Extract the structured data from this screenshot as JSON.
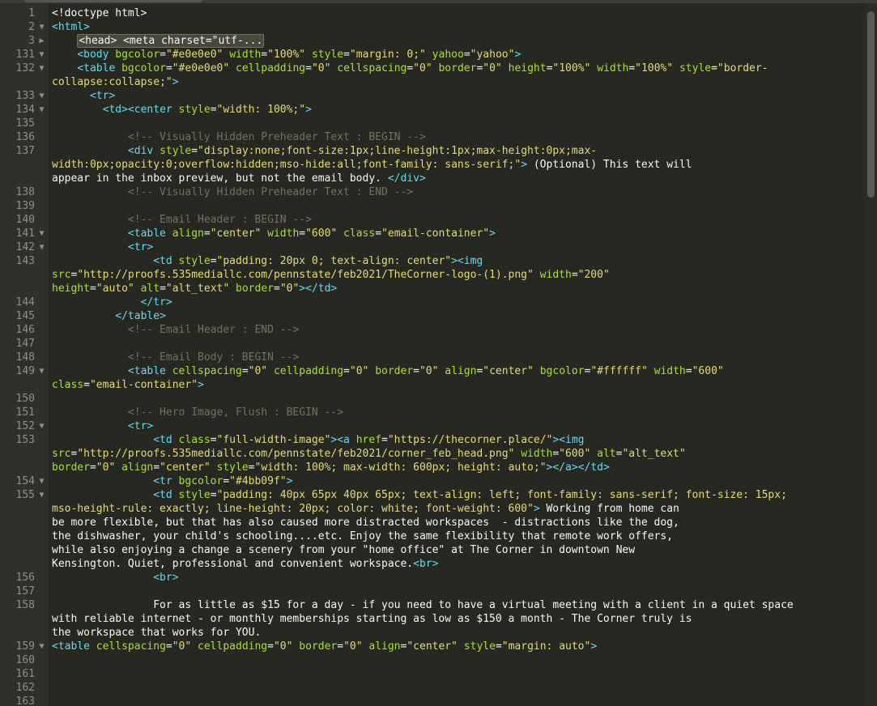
{
  "editor": {
    "lines": [
      {
        "n": "1",
        "fold": "",
        "html": "<span class=\"p\">&lt;!doctype html&gt;</span>"
      },
      {
        "n": "2",
        "fold": "▼",
        "html": "<span class=\"t\">&lt;html&gt;</span>"
      },
      {
        "n": "3",
        "fold": "▶",
        "html": "    <span class=\"folded\">&lt;head&gt; &lt;meta charset=\"utf-...</span>"
      },
      {
        "n": "131",
        "fold": "▼",
        "html": "    <span class=\"t\">&lt;body</span> <span class=\"a\">bgcolor</span>=<span class=\"s\">\"#e0e0e0\"</span> <span class=\"a\">width</span>=<span class=\"s\">\"100%\"</span> <span class=\"a\">style</span>=<span class=\"s\">\"margin: 0;\"</span> <span class=\"a\">yahoo</span>=<span class=\"s\">\"yahoo\"</span><span class=\"t\">&gt;</span>"
      },
      {
        "n": "132",
        "fold": "▼",
        "html": "    <span class=\"t\">&lt;table</span> <span class=\"a\">bgcolor</span>=<span class=\"s\">\"#e0e0e0\"</span> <span class=\"a\">cellpadding</span>=<span class=\"s\">\"0\"</span> <span class=\"a\">cellspacing</span>=<span class=\"s\">\"0\"</span> <span class=\"a\">border</span>=<span class=\"s\">\"0\"</span> <span class=\"a\">height</span>=<span class=\"s\">\"100%\"</span> <span class=\"a\">width</span>=<span class=\"s\">\"100%\"</span> <span class=\"a\">style</span>=<span class=\"s\">\"border-\ncollapse:collapse;\"</span><span class=\"t\">&gt;</span>"
      },
      {
        "n": "133",
        "fold": "▼",
        "html": "      <span class=\"t\">&lt;tr&gt;</span>"
      },
      {
        "n": "134",
        "fold": "▼",
        "html": "        <span class=\"t\">&lt;td&gt;&lt;center</span> <span class=\"a\">style</span>=<span class=\"s\">\"width: 100%;\"</span><span class=\"t\">&gt;</span>"
      },
      {
        "n": "135",
        "fold": "",
        "html": ""
      },
      {
        "n": "136",
        "fold": "",
        "html": "            <span class=\"c\">&lt;!-- Visually Hidden Preheader Text : BEGIN --&gt;</span>"
      },
      {
        "n": "137",
        "fold": "",
        "html": "            <span class=\"t\">&lt;div</span> <span class=\"a\">style</span>=<span class=\"s\">\"display:none;font-size:1px;line-height:1px;max-height:0px;max-\nwidth:0px;opacity:0;overflow:hidden;mso-hide:all;font-family: sans-serif;\"</span><span class=\"t\">&gt;</span> (Optional) This text will\nappear in the inbox preview, but not the email body. <span class=\"t\">&lt;/div&gt;</span>"
      },
      {
        "n": "138",
        "fold": "",
        "html": "            <span class=\"c\">&lt;!-- Visually Hidden Preheader Text : END --&gt;</span>"
      },
      {
        "n": "139",
        "fold": "",
        "html": ""
      },
      {
        "n": "140",
        "fold": "",
        "html": "            <span class=\"c\">&lt;!-- Email Header : BEGIN --&gt;</span>"
      },
      {
        "n": "141",
        "fold": "▼",
        "html": "            <span class=\"t\">&lt;table</span> <span class=\"a\">align</span>=<span class=\"s\">\"center\"</span> <span class=\"a\">width</span>=<span class=\"s\">\"600\"</span> <span class=\"a\">class</span>=<span class=\"s\">\"email-container\"</span><span class=\"t\">&gt;</span>"
      },
      {
        "n": "142",
        "fold": "▼",
        "html": "            <span class=\"t\">&lt;tr&gt;</span>"
      },
      {
        "n": "143",
        "fold": "",
        "html": "                <span class=\"t\">&lt;td</span> <span class=\"a\">style</span>=<span class=\"s\">\"padding: 20px 0; text-align: center\"</span><span class=\"t\">&gt;&lt;img</span>\n<span class=\"a\">src</span>=<span class=\"s\">\"http://proofs.535mediallc.com/pennstate/feb2021/TheCorner-logo-(1).png\"</span> <span class=\"a\">width</span>=<span class=\"s\">\"200\"</span>\n<span class=\"a\">height</span>=<span class=\"s\">\"auto\"</span> <span class=\"a\">alt</span>=<span class=\"s\">\"alt_text\"</span> <span class=\"a\">border</span>=<span class=\"s\">\"0\"</span><span class=\"t\">&gt;&lt;/td&gt;</span>"
      },
      {
        "n": "144",
        "fold": "",
        "html": "              <span class=\"t\">&lt;/tr&gt;</span>"
      },
      {
        "n": "145",
        "fold": "",
        "html": "          <span class=\"t\">&lt;/table&gt;</span>"
      },
      {
        "n": "146",
        "fold": "",
        "html": "            <span class=\"c\">&lt;!-- Email Header : END --&gt;</span>"
      },
      {
        "n": "147",
        "fold": "",
        "html": ""
      },
      {
        "n": "148",
        "fold": "",
        "html": "            <span class=\"c\">&lt;!-- Email Body : BEGIN --&gt;</span>"
      },
      {
        "n": "149",
        "fold": "▼",
        "html": "            <span class=\"t\">&lt;table</span> <span class=\"a\">cellspacing</span>=<span class=\"s\">\"0\"</span> <span class=\"a\">cellpadding</span>=<span class=\"s\">\"0\"</span> <span class=\"a\">border</span>=<span class=\"s\">\"0\"</span> <span class=\"a\">align</span>=<span class=\"s\">\"center\"</span> <span class=\"a\">bgcolor</span>=<span class=\"s\">\"#ffffff\"</span> <span class=\"a\">width</span>=<span class=\"s\">\"600\"</span>\n<span class=\"a\">class</span>=<span class=\"s\">\"email-container\"</span><span class=\"t\">&gt;</span>"
      },
      {
        "n": "150",
        "fold": "",
        "html": ""
      },
      {
        "n": "151",
        "fold": "",
        "html": "            <span class=\"c\">&lt;!-- Hero Image, Flush : BEGIN --&gt;</span>"
      },
      {
        "n": "152",
        "fold": "▼",
        "html": "            <span class=\"t\">&lt;tr&gt;</span>"
      },
      {
        "n": "153",
        "fold": "",
        "html": "                <span class=\"t\">&lt;td</span> <span class=\"a\">class</span>=<span class=\"s\">\"full-width-image\"</span><span class=\"t\">&gt;&lt;a</span> <span class=\"a\">href</span>=<span class=\"s\">\"https://thecorner.place/\"</span><span class=\"t\">&gt;&lt;img</span>\n<span class=\"a\">src</span>=<span class=\"s\">\"http://proofs.535mediallc.com/pennstate/feb2021/corner_feb_head.png\"</span> <span class=\"a\">width</span>=<span class=\"s\">\"600\"</span> <span class=\"a\">alt</span>=<span class=\"s\">\"alt_text\"</span>\n<span class=\"a\">border</span>=<span class=\"s\">\"0\"</span> <span class=\"a\">align</span>=<span class=\"s\">\"center\"</span> <span class=\"a\">style</span>=<span class=\"s\">\"width: 100%; max-width: 600px; height: auto;\"</span><span class=\"t\">&gt;&lt;/a&gt;&lt;/td&gt;</span>"
      },
      {
        "n": "154",
        "fold": "▼",
        "html": "                <span class=\"t\">&lt;tr</span> <span class=\"a\">bgcolor</span>=<span class=\"s\">\"#4bb09f\"</span><span class=\"t\">&gt;</span>"
      },
      {
        "n": "155",
        "fold": "▼",
        "html": "                <span class=\"t\">&lt;td</span> <span class=\"a\">style</span>=<span class=\"s\">\"padding: 40px 65px 40px 65px; text-align: left; font-family: sans-serif; font-size: 15px;\nmso-height-rule: exactly; line-height: 20px; color: white; font-weight: 600\"</span><span class=\"t\">&gt;</span> Working from home can\nbe more flexible, but that has also caused more distracted workspaces  - distractions like the dog,\nthe dishwasher, your child's schooling....etc. Enjoy the same flexibility that remote work offers,\nwhile also enjoying a change a scenery from your \"home office\" at The Corner in downtown New\nKensington. Quiet, professional and convenient workspace.<span class=\"t\">&lt;br&gt;</span>"
      },
      {
        "n": "156",
        "fold": "",
        "html": "                <span class=\"t\">&lt;br&gt;</span>"
      },
      {
        "n": "157",
        "fold": "",
        "html": ""
      },
      {
        "n": "158",
        "fold": "",
        "html": "                For as little as $15 for a day - if you need to have a virtual meeting with a client in a quiet space\nwith reliable internet - or monthly memberships starting as low as $150 a month - The Corner truly is\nthe workspace that works for YOU."
      },
      {
        "n": "159",
        "fold": "▼",
        "html": "<span class=\"t\">&lt;table</span> <span class=\"a\">cellspacing</span>=<span class=\"s\">\"0\"</span> <span class=\"a\">cellpadding</span>=<span class=\"s\">\"0\"</span> <span class=\"a\">border</span>=<span class=\"s\">\"0\"</span> <span class=\"a\">align</span>=<span class=\"s\">\"center\"</span> <span class=\"a\">style</span>=<span class=\"s\">\"margin: auto\"</span><span class=\"t\">&gt;</span>"
      },
      {
        "n": "160",
        "fold": "",
        "html": ""
      },
      {
        "n": "161",
        "fold": "",
        "html": ""
      },
      {
        "n": "162",
        "fold": "",
        "html": ""
      },
      {
        "n": "163",
        "fold": "",
        "html": ""
      }
    ]
  }
}
